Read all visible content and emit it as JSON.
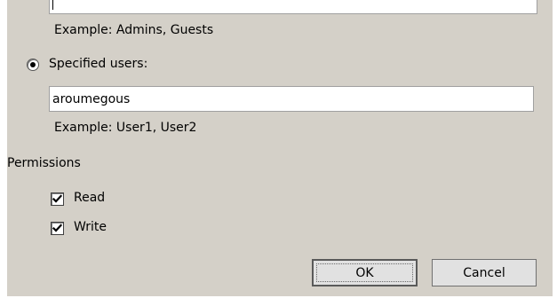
{
  "groups_example": "Example: Admins, Guests",
  "specified_users": {
    "label": "Specified users:",
    "selected": true,
    "value": "aroumegous",
    "example": "Example: User1, User2"
  },
  "permissions": {
    "heading": "Permissions",
    "items": [
      {
        "label": "Read",
        "checked": true
      },
      {
        "label": "Write",
        "checked": true
      }
    ]
  },
  "buttons": {
    "ok": "OK",
    "cancel": "Cancel"
  }
}
